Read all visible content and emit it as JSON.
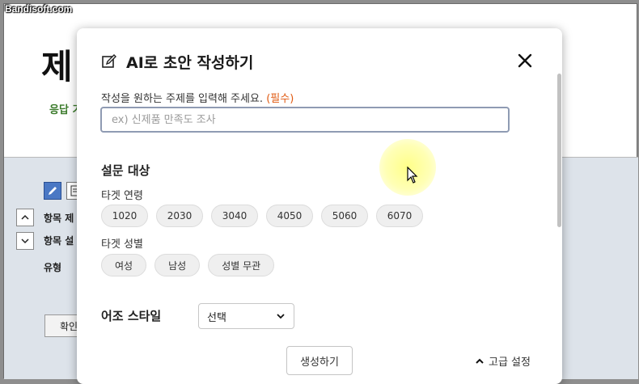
{
  "watermark": "Bandisoft.com",
  "background": {
    "title_fragment": "제",
    "subtitle_fragment": "응답 기",
    "rows": [
      {
        "label": "항목 제"
      },
      {
        "label": "항목 설"
      },
      {
        "label": "유형"
      }
    ],
    "confirm_label": "확인"
  },
  "modal": {
    "title": "AI로 초안 작성하기",
    "prompt_label": "작성을 원하는 주제를 입력해 주세요.",
    "required_mark": "(필수)",
    "topic_input": {
      "value": "",
      "placeholder": "ex) 신제품 만족도 조사"
    },
    "audience_section_title": "설문 대상",
    "age_label": "타겟 연령",
    "age_options": [
      "1020",
      "2030",
      "3040",
      "4050",
      "5060",
      "6070"
    ],
    "gender_label": "타겟 성별",
    "gender_options": [
      "여성",
      "남성",
      "성별 무관"
    ],
    "style_label": "어조 스타일",
    "style_select_value": "선택",
    "generate_label": "생성하기",
    "advanced_label": "고급 설정"
  },
  "colors": {
    "required": "#e05a12",
    "input_border": "#8f9bb3",
    "chip_bg": "#efefef",
    "bg_panel": "#dde3ea",
    "subtitle_green": "#3a7a2a"
  }
}
